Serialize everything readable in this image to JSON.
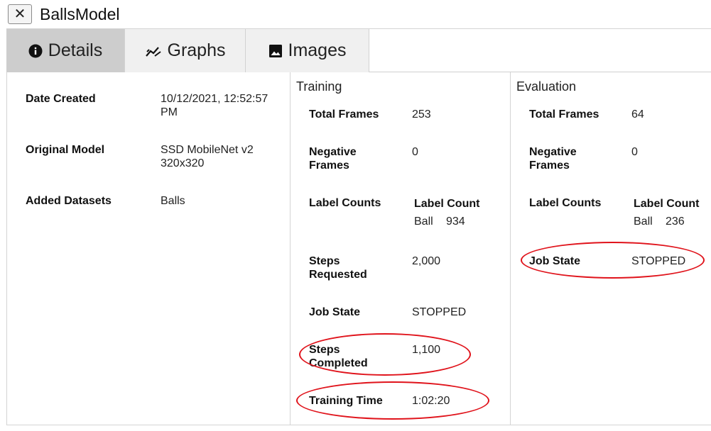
{
  "window": {
    "title": "BallsModel",
    "close_icon": "close-icon"
  },
  "tabs": [
    {
      "label": "Details",
      "icon": "info-icon",
      "active": true
    },
    {
      "label": "Graphs",
      "icon": "graph-icon",
      "active": false
    },
    {
      "label": "Images",
      "icon": "image-icon",
      "active": false
    }
  ],
  "details": {
    "date_created_label": "Date Created",
    "date_created_value_line1": "10/12/2021, 12:52:57",
    "date_created_value_line2": "PM",
    "original_model_label": "Original Model",
    "original_model_value_line1": "SSD MobileNet v2",
    "original_model_value_line2": "320x320",
    "added_datasets_label": "Added Datasets",
    "added_datasets_value": "Balls"
  },
  "training": {
    "heading": "Training",
    "total_frames_label": "Total Frames",
    "total_frames_value": "253",
    "negative_frames_label_line1": "Negative",
    "negative_frames_label_line2": "Frames",
    "negative_frames_value": "0",
    "label_counts_label": "Label Counts",
    "label_count_header": "Label Count",
    "label_row_label": "Ball",
    "label_row_count": "934",
    "steps_requested_label_line1": "Steps",
    "steps_requested_label_line2": "Requested",
    "steps_requested_value": "2,000",
    "job_state_label": "Job State",
    "job_state_value": "STOPPED",
    "steps_completed_label_line1": "Steps",
    "steps_completed_label_line2": "Completed",
    "steps_completed_value": "1,100",
    "training_time_label": "Training Time",
    "training_time_value": "1:02:20"
  },
  "evaluation": {
    "heading": "Evaluation",
    "total_frames_label": "Total Frames",
    "total_frames_value": "64",
    "negative_frames_label_line1": "Negative",
    "negative_frames_label_line2": "Frames",
    "negative_frames_value": "0",
    "label_counts_label": "Label Counts",
    "label_count_header": "Label Count",
    "label_row_label": "Ball",
    "label_row_count": "236",
    "job_state_label": "Job State",
    "job_state_value": "STOPPED"
  },
  "annotation_color": "#e0131b"
}
